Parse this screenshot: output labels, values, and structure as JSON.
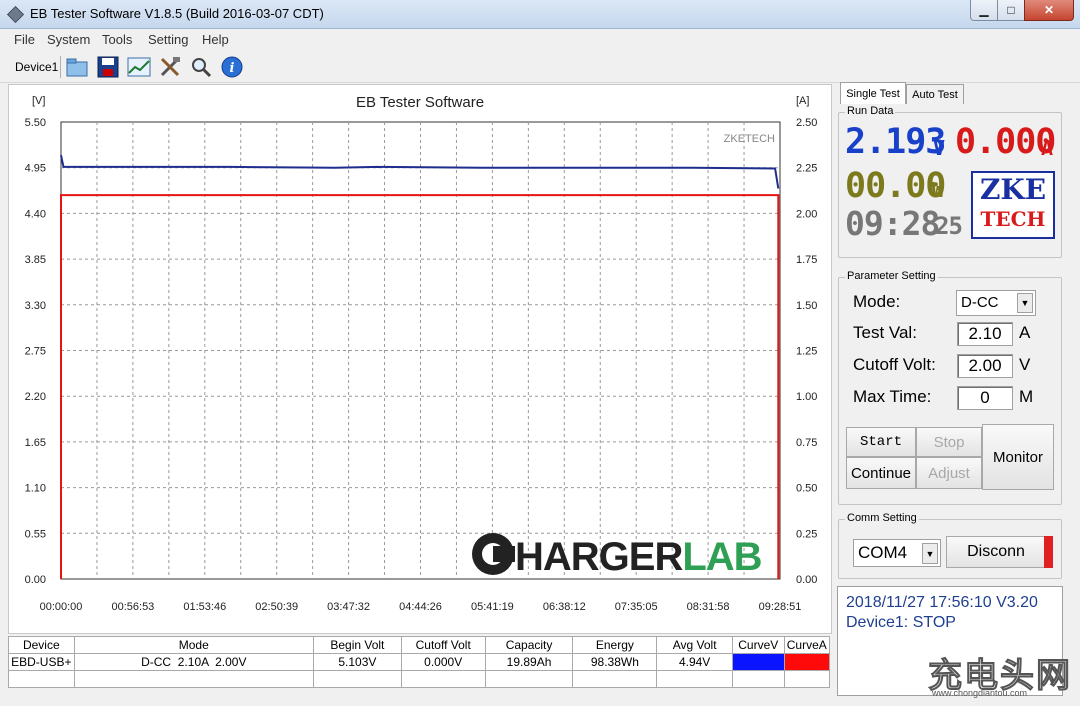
{
  "window": {
    "title": "EB Tester Software V1.8.5 (Build 2016-03-07 CDT)",
    "min": "▁",
    "max": "□",
    "close": "✕"
  },
  "menu": [
    "File",
    "System",
    "Tools",
    "Setting",
    "Help"
  ],
  "toolbar": {
    "device": "Device1",
    "icons": [
      "open-folder-icon",
      "save-icon",
      "chart-icon",
      "tools-icon",
      "search-icon",
      "info-icon"
    ]
  },
  "chart_data": {
    "type": "line",
    "title": "EB Tester Software",
    "watermark_top": "ZKETECH",
    "watermark_logo": "HARGERLAB",
    "left_axis": {
      "unit": "[V]",
      "ticks": [
        "5.50",
        "4.95",
        "4.40",
        "3.85",
        "3.30",
        "2.75",
        "2.20",
        "1.65",
        "1.10",
        "0.55",
        "0.00"
      ],
      "ylim": [
        0,
        5.5
      ]
    },
    "right_axis": {
      "unit": "[A]",
      "ticks": [
        "2.50",
        "2.25",
        "2.00",
        "1.75",
        "1.50",
        "1.25",
        "1.00",
        "0.75",
        "0.50",
        "0.25",
        "0.00"
      ],
      "ylim": [
        0,
        2.5
      ]
    },
    "x_ticks": [
      "00:00:00",
      "00:56:53",
      "01:53:46",
      "02:50:39",
      "03:47:32",
      "04:44:26",
      "05:41:19",
      "06:38:12",
      "07:35:05",
      "08:31:58",
      "09:28:51"
    ],
    "xlim_seconds": [
      0,
      34131
    ],
    "series": [
      {
        "axis": "left",
        "color": "#1f2d8f",
        "points": [
          [
            0,
            5.1
          ],
          [
            120,
            4.96
          ],
          [
            8000,
            4.96
          ],
          [
            13000,
            4.95
          ],
          [
            15000,
            4.96
          ],
          [
            20000,
            4.95
          ],
          [
            25000,
            4.95
          ],
          [
            30000,
            4.95
          ],
          [
            33900,
            4.94
          ],
          [
            34050,
            4.7
          ]
        ]
      },
      {
        "axis": "right",
        "color": "#e81414",
        "points": [
          [
            0,
            0
          ],
          [
            0,
            2.1
          ],
          [
            34050,
            2.1
          ],
          [
            34050,
            0
          ]
        ]
      }
    ]
  },
  "table": {
    "headers": [
      "Device",
      "Mode",
      "Begin Volt",
      "Cutoff Volt",
      "Capacity",
      "Energy",
      "Avg Volt",
      "CurveV",
      "CurveA"
    ],
    "row": [
      "EBD-USB+",
      "D-CC  2.10A  2.00V",
      "5.103V",
      "0.000V",
      "19.89Ah",
      "98.38Wh",
      "4.94V"
    ],
    "curve_colors": [
      "#0a14ff",
      "#ff0a0a"
    ]
  },
  "tabs": [
    "Single Test",
    "Auto Test"
  ],
  "run_data": {
    "label": "Run Data",
    "voltage": "2.193",
    "voltage_unit": "V",
    "current": "0.000",
    "current_unit": "A",
    "power": "00.00",
    "power_unit": "W",
    "time": "09:28",
    "seconds": "25",
    "logo_top": "ZKE",
    "logo_bottom": "TECH"
  },
  "params": {
    "label": "Parameter Setting",
    "mode_label": "Mode:",
    "mode_value": "D-CC",
    "test_val_label": "Test Val:",
    "test_val": "2.10",
    "test_unit": "A",
    "cutoff_label": "Cutoff Volt:",
    "cutoff_val": "2.00",
    "cutoff_unit": "V",
    "maxtime_label": "Max Time:",
    "maxtime_val": "0",
    "maxtime_unit": "M"
  },
  "buttons": {
    "start": "Start",
    "stop": "Stop",
    "continue": "Continue",
    "adjust": "Adjust",
    "monitor": "Monitor"
  },
  "comm": {
    "label": "Comm Setting",
    "port": "COM4",
    "disconn": "Disconn"
  },
  "status": {
    "line1": "2018/11/27 17:56:10  V3.20",
    "line2": "Device1: STOP"
  },
  "site_watermark": {
    "main": "充电头网",
    "url": "www.chongdiantou.com"
  }
}
